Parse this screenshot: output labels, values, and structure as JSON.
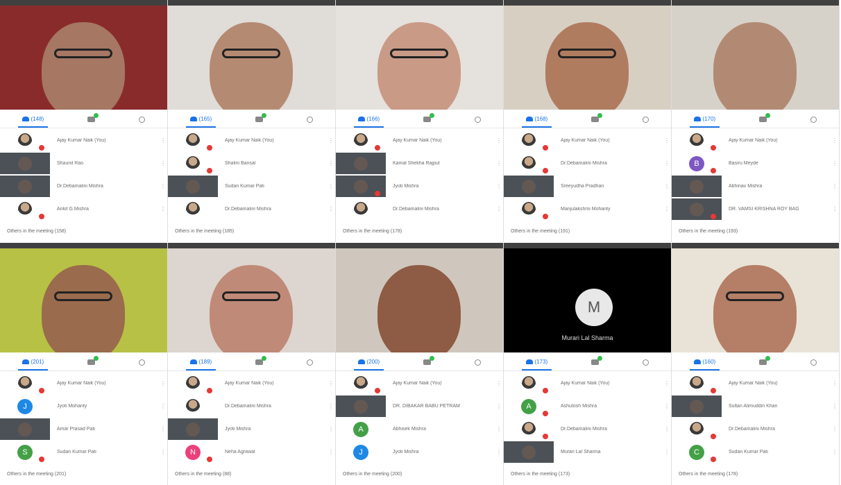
{
  "tiles": [
    {
      "tab_count": "(148)",
      "video": {
        "bg": "#8a2b2b",
        "head": "#a67763",
        "glasses": true
      },
      "rows": [
        {
          "avatar": "photo",
          "name": "Ajay Kumar Naik (You)",
          "mic": true
        },
        {
          "avatar": "thumb",
          "name": "Shaunil Rao",
          "mic": false
        },
        {
          "avatar": "thumb",
          "name": "Dr.Debamalini Mishra",
          "mic": false
        },
        {
          "avatar": "photo",
          "name": "Ankit G.Mishra",
          "mic": true
        }
      ],
      "footer": "Others in the meeting (158)"
    },
    {
      "tab_count": "(165)",
      "video": {
        "bg": "#e0dcd8",
        "head": "#b58a72",
        "glasses": true
      },
      "rows": [
        {
          "avatar": "photo",
          "name": "Ajay Kumar Naik (You)",
          "mic": true
        },
        {
          "avatar": "photo",
          "name": "Shalini Bansal",
          "mic": true
        },
        {
          "avatar": "thumb",
          "name": "Sudan Kumar Pati",
          "mic": false
        },
        {
          "avatar": "photo",
          "name": "Dr.Debamalini Mishra",
          "mic": false
        }
      ],
      "footer": "Others in the meeting (185)"
    },
    {
      "tab_count": "(166)",
      "video": {
        "bg": "#e5e1dc",
        "head": "#c99a86",
        "glasses": true
      },
      "rows": [
        {
          "avatar": "photo",
          "name": "Ajay Kumar Naik (You)",
          "mic": true
        },
        {
          "avatar": "thumb",
          "name": "Kamal Shekha Rajput",
          "mic": false
        },
        {
          "avatar": "thumb",
          "name": "Jyoti Mishra",
          "mic": true
        },
        {
          "avatar": "photo",
          "name": "Dr.Debamalini Mishra",
          "mic": false
        }
      ],
      "footer": "Others in the meeting (178)"
    },
    {
      "tab_count": "(168)",
      "video": {
        "bg": "#d8cfc3",
        "head": "#b07c60",
        "glasses": true
      },
      "rows": [
        {
          "avatar": "photo",
          "name": "Ajay Kumar Naik (You)",
          "mic": true
        },
        {
          "avatar": "photo",
          "name": "Dr.Debamalini Mishra",
          "mic": true
        },
        {
          "avatar": "thumb",
          "name": "Sreeyudha Pradhan",
          "mic": false
        },
        {
          "avatar": "photo",
          "name": "Manjulakshmi Mohanty",
          "mic": true
        }
      ],
      "footer": "Others in the meeting (191)"
    },
    {
      "tab_count": "(170)",
      "video": {
        "bg": "#d6d2c9",
        "head": "#b28a73",
        "glasses": false
      },
      "rows": [
        {
          "avatar": "photo",
          "name": "Ajay Kumar Naik (You)",
          "mic": true
        },
        {
          "avatar": "circle",
          "letter": "B",
          "color": "#7e57c2",
          "name": "Basiru Meyde",
          "mic": true
        },
        {
          "avatar": "thumb",
          "name": "Abhinav Mishra",
          "mic": false
        },
        {
          "avatar": "thumb",
          "name": "DR. VAMSI KRISHNA ROY BAG",
          "mic": true
        }
      ],
      "footer": "Others in the meeting (193)"
    },
    {
      "tab_count": "(201)",
      "video": {
        "bg": "#b7c146",
        "head": "#9a6b4c",
        "glasses": true
      },
      "rows": [
        {
          "avatar": "photo",
          "name": "Ajay Kumar Naik (You)",
          "mic": true
        },
        {
          "avatar": "circle",
          "letter": "J",
          "color": "#1e88e5",
          "name": "Jyoti Mohanty",
          "mic": false
        },
        {
          "avatar": "thumb",
          "name": "Amar Prasad Pati",
          "mic": false
        },
        {
          "avatar": "circle",
          "letter": "S",
          "color": "#43a047",
          "name": "Sudan Kumar Pati",
          "mic": true
        }
      ],
      "footer": "Others in the meeting (201)"
    },
    {
      "tab_count": "(189)",
      "video": {
        "bg": "#ddd5d0",
        "head": "#c08a78",
        "glasses": true
      },
      "rows": [
        {
          "avatar": "photo",
          "name": "Ajay Kumar Naik (You)",
          "mic": true
        },
        {
          "avatar": "photo",
          "name": "Dr.Debamalini Mishra",
          "mic": false
        },
        {
          "avatar": "thumb",
          "name": "Jyoti Mishra",
          "mic": false
        },
        {
          "avatar": "circle",
          "letter": "N",
          "color": "#ec407a",
          "name": "Neha Agrawal",
          "mic": true
        }
      ],
      "footer": "Others in the meeting (88)"
    },
    {
      "tab_count": "(200)",
      "video": {
        "bg": "#cfc7bd",
        "head": "#8e5b44",
        "glasses": false
      },
      "rows": [
        {
          "avatar": "photo",
          "name": "Ajay Kumar Naik (You)",
          "mic": true
        },
        {
          "avatar": "thumb",
          "name": "DR. DIBAKAR BABU PETRAM",
          "mic": false
        },
        {
          "avatar": "circle",
          "letter": "A",
          "color": "#43a047",
          "name": "Abhisek Mishra",
          "mic": false
        },
        {
          "avatar": "circle",
          "letter": "J",
          "color": "#1e88e5",
          "name": "Jyoti Mishra",
          "mic": false
        }
      ],
      "footer": "Others in the meeting (200)"
    },
    {
      "tab_count": "(173)",
      "video": {
        "bg": "#000000",
        "head": "",
        "glasses": false,
        "avatar_letter": "M",
        "avatar_name": "Murari Lal Sharma"
      },
      "rows": [
        {
          "avatar": "photo",
          "name": "Ajay Kumar Naik (You)",
          "mic": true
        },
        {
          "avatar": "circle",
          "letter": "A",
          "color": "#43a047",
          "name": "Ashutosh Mishra",
          "mic": true
        },
        {
          "avatar": "photo",
          "name": "Dr.Debamalini Mishra",
          "mic": true
        },
        {
          "avatar": "thumb",
          "name": "Murari Lal Sharma",
          "mic": false
        }
      ],
      "footer": "Others in the meeting (173)"
    },
    {
      "tab_count": "(160)",
      "video": {
        "bg": "#e8e3d6",
        "head": "#b57e66",
        "glasses": true
      },
      "rows": [
        {
          "avatar": "photo",
          "name": "Ajay Kumar Naik (You)",
          "mic": true
        },
        {
          "avatar": "thumb",
          "name": "Sultan Alimuddin Khan",
          "mic": false
        },
        {
          "avatar": "photo",
          "name": "Dr.Debamalini Mishra",
          "mic": true
        },
        {
          "avatar": "circle",
          "letter": "C",
          "color": "#43a047",
          "name": "Sudan Kumar Pati",
          "mic": true
        }
      ],
      "footer": "Others in the meeting (178)"
    }
  ]
}
